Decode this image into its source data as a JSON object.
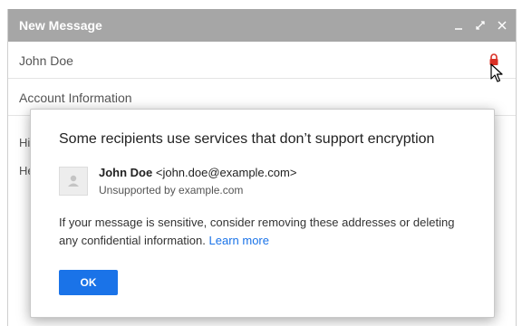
{
  "compose": {
    "title": "New Message",
    "recipient": "John Doe",
    "subject": "Account Information",
    "body_line1": "Hi",
    "body_line2": "He"
  },
  "dialog": {
    "title": "Some recipients use services that don’t support encryption",
    "recipient_name": "John Doe",
    "recipient_email": "<john.doe@example.com>",
    "recipient_status": "Unsupported by example.com",
    "message": "If your message is sensitive, consider removing these addresses or deleting any confidential information.",
    "learn_more": "Learn more",
    "ok_label": "OK"
  },
  "icons": [
    "minimize-icon",
    "expand-icon",
    "close-icon",
    "lock-icon",
    "avatar-icon"
  ],
  "colors": {
    "title_bar": "#a6a6a6",
    "lock_icon": "#d93025",
    "link": "#1a73e8",
    "button": "#1a73e8"
  }
}
